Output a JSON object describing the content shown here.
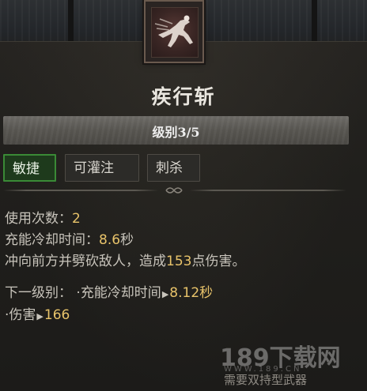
{
  "skill": {
    "name": "疾行斩",
    "level_label": "级别3/5",
    "icon": "running-slash-icon"
  },
  "tags": [
    {
      "label": "敏捷",
      "active": true
    },
    {
      "label": "可灌注",
      "active": false
    },
    {
      "label": "刺杀",
      "active": false
    }
  ],
  "stats": {
    "uses_label": "使用次数：",
    "uses_value": "2",
    "cooldown_label": "充能冷却时间：",
    "cooldown_value": "8.6",
    "cooldown_unit": "秒",
    "desc_prefix": "冲向前方并劈砍敌人，造成",
    "desc_value": "153",
    "desc_suffix": "点伤害。"
  },
  "next_level": {
    "label": "下一级别：",
    "bullet": "·",
    "cooldown_label": "充能冷却时间",
    "cooldown_value": "8.12",
    "cooldown_unit": "秒",
    "damage_label": "伤害",
    "damage_value": "166"
  },
  "requirement": "需要双持型武器",
  "watermark": {
    "text": "189下载网",
    "url": "WWW.189.CN"
  },
  "colors": {
    "highlight": "#e8c36a",
    "active_tag_border": "#3a8a36",
    "active_tag_bg": "#1e3a1c"
  }
}
